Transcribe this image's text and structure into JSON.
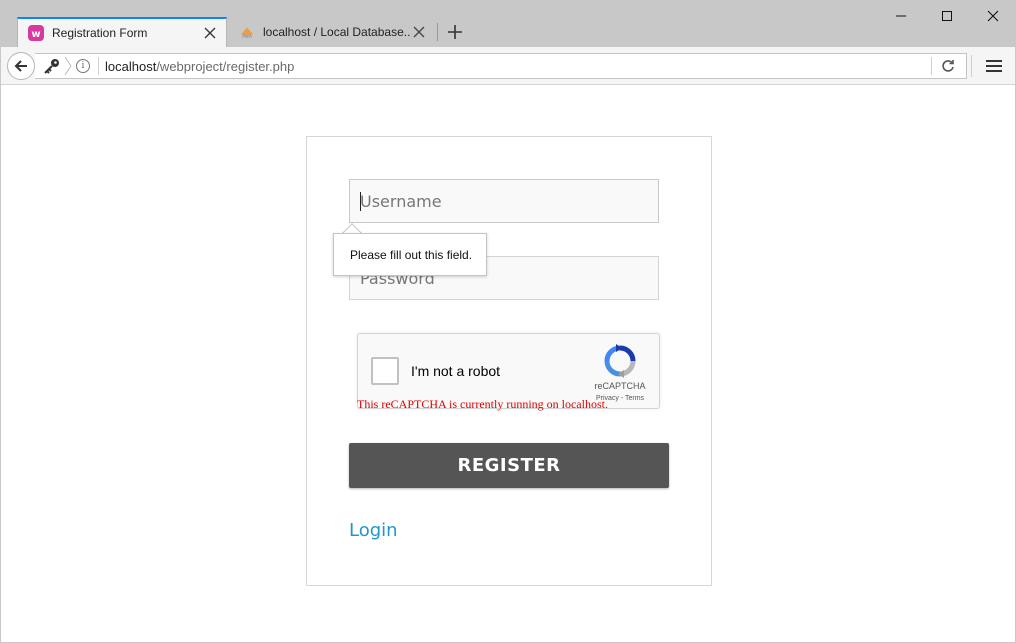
{
  "browser": {
    "tabs": [
      {
        "title": "Registration Form",
        "icon": "wampserver-icon",
        "active": true
      },
      {
        "title": "localhost / Local Database...",
        "icon": "phpmyadmin-icon",
        "active": false
      }
    ],
    "url": {
      "host": "localhost",
      "path": "/webproject/register.php"
    },
    "accent_color": "#0a84ff"
  },
  "form": {
    "username_placeholder": "Username",
    "password_placeholder": "Password",
    "validation_tooltip": "Please fill out this field.",
    "captcha": {
      "label": "I'm not a robot",
      "brand": "reCAPTCHA",
      "links": "Privacy - Terms",
      "warning": "This reCAPTCHA is currently running on localhost."
    },
    "register_label": "REGISTER",
    "login_label": "Login",
    "button_color": "#555555",
    "link_color": "#2196c9",
    "warning_color": "#e00000"
  }
}
